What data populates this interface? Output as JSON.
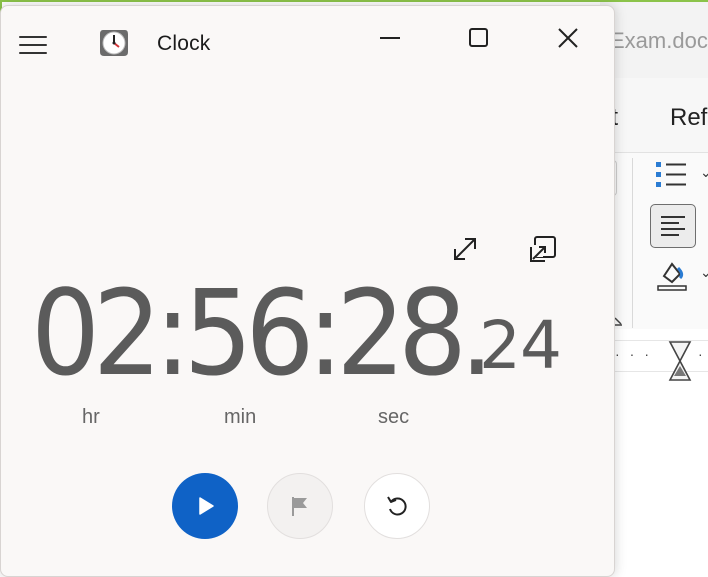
{
  "background_app": {
    "document_title": "Exam.doc",
    "menu": [
      "ut",
      "Ref"
    ],
    "icons": [
      "bulleted-list-icon",
      "align-left-icon",
      "fill-color-icon",
      "hourglass-icon"
    ]
  },
  "clock_app": {
    "title": "Clock",
    "window_controls": [
      "minimize",
      "maximize",
      "close"
    ],
    "stopwatch": {
      "time_main": "02:56:28.",
      "time_fraction": "24",
      "units": {
        "hr": "hr",
        "min": "min",
        "sec": "sec"
      }
    },
    "controls": [
      "play",
      "lap",
      "reset"
    ],
    "colors": {
      "accent": "#0f62c6",
      "background": "#faf8f7",
      "digits": "#5b5b5b"
    }
  }
}
